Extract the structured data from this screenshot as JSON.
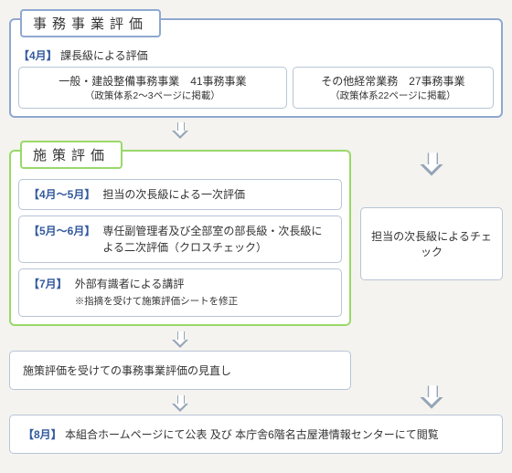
{
  "section1": {
    "title": "事務事業評価",
    "subhead_tag": "【4月】",
    "subhead_text": "課長級による評価",
    "box_left": {
      "line1": "一般・建設整備事務事業　41事務事業",
      "line2": "（政策体系2～3ページに掲載）"
    },
    "box_right": {
      "line1": "その他経常業務　27事務事業",
      "line2": "（政策体系22ページに掲載）"
    }
  },
  "section2": {
    "title": "施策評価",
    "rows": [
      {
        "tag": "【4月～5月】",
        "text": "担当の次長級による一次評価",
        "sub": ""
      },
      {
        "tag": "【5月～6月】",
        "text": "専任副管理者及び全部室の部長級・次長級による二次評価（クロスチェック）",
        "sub": ""
      },
      {
        "tag": "【7月】",
        "text": "外部有識者による講評",
        "sub": "※指摘を受けて施策評価シートを修正"
      }
    ]
  },
  "check_box": "担当の次長級によるチェック",
  "review_box": "施策評価を受けての事務事業評価の見直し",
  "final": {
    "tag": "【8月】",
    "text": "本組合ホームページにて公表 及び 本庁舎6階名古屋港情報センターにて閲覧"
  }
}
